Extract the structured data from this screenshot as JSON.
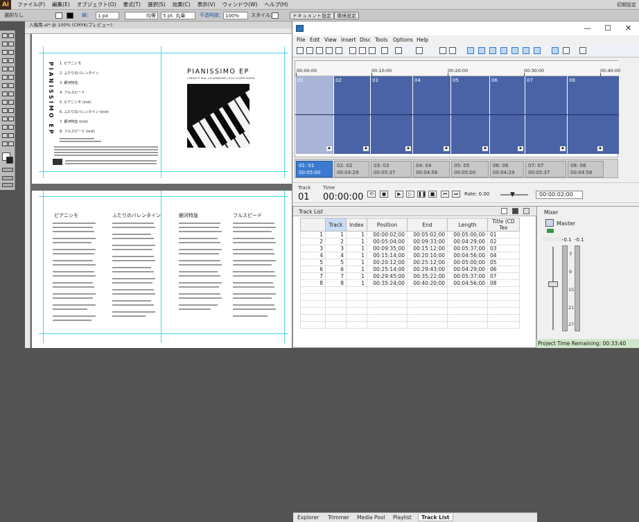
{
  "illustrator": {
    "logo": "Ai",
    "menus": [
      "ファイル(F)",
      "編集(E)",
      "オブジェクト(O)",
      "書式(T)",
      "選択(S)",
      "効果(C)",
      "表示(V)",
      "ウィンドウ(W)",
      "ヘルプ(H)"
    ],
    "workspace": "初期設定",
    "control": {
      "selection": "選択なし",
      "stroke_label": "線：",
      "stroke_value": "1 px",
      "stroke_style": "均等",
      "brush": "5 pt. 丸筆",
      "opacity_label": "不透明度：",
      "opacity_value": "100%",
      "style_label": "スタイル：",
      "doc_setup": "ドキュメント設定",
      "prefs": "環境設定"
    },
    "doc_tab": "入稿用.ai* @ 100% (CMYK/プレビュー)",
    "front": {
      "title": "PIANISSIMO EP",
      "subtitle": "J PROJECT feat. LIA KAWASAKI / ELLY COVER ALBUM",
      "spine_title": "PIANISSIMO EP",
      "tracks": [
        "1. ピアニシモ",
        "2. ふたりのバレンタイン",
        "3. 銀河特急",
        "4. フルスピード",
        "5. ピアニシモ (inst)",
        "6. ふたりのバレンタイン (inst)",
        "7. 銀河特急 (inst)",
        "8. フルスピード (inst)"
      ]
    },
    "lyrics_titles": [
      "ピアニシモ",
      "ふたりのバレンタイン",
      "銀河特急",
      "フルスピード"
    ]
  },
  "soundforge": {
    "menus": [
      "File",
      "Edit",
      "View",
      "Insert",
      "Disc",
      "Tools",
      "Options",
      "Help"
    ],
    "window_controls": [
      "—",
      "☐",
      "✕"
    ],
    "ruler": [
      "00:00:00",
      "00:10:00",
      "00:20:00",
      "00:30:00",
      "00:40:00"
    ],
    "segments": [
      "01",
      "02",
      "03",
      "04",
      "05",
      "06",
      "07",
      "08"
    ],
    "markers": [
      {
        "top": "01: 01",
        "bottom": "00:05:00"
      },
      {
        "top": "02: 02",
        "bottom": "00:04:29"
      },
      {
        "top": "03: 03",
        "bottom": "00:05:37"
      },
      {
        "top": "04: 04",
        "bottom": "00:04:56"
      },
      {
        "top": "05: 05",
        "bottom": "00:05:00"
      },
      {
        "top": "06: 06",
        "bottom": "00:04:29"
      },
      {
        "top": "07: 07",
        "bottom": "00:05:37"
      },
      {
        "top": "08: 08",
        "bottom": "00:04:56"
      }
    ],
    "transport": {
      "track_label": "Track",
      "track_value": "01",
      "time_label": "Time",
      "time_value": "00:00:00",
      "rate": "Rate: 0.00",
      "time_field": "00:00:02;00"
    },
    "tracklist": {
      "title": "Track List",
      "columns": [
        "",
        "Track",
        "Index",
        "Position",
        "End",
        "Length",
        "Title (CD Tex"
      ],
      "rows": [
        [
          "1",
          "1",
          "1",
          "00:00:02;00",
          "00:05:02;00",
          "00:05:00;00",
          "01"
        ],
        [
          "2",
          "2",
          "1",
          "00:05:04;00",
          "00:09:33;00",
          "00:04:29;00",
          "02"
        ],
        [
          "3",
          "3",
          "1",
          "00:09:35;00",
          "00:15:12;00",
          "00:05:37;00",
          "03"
        ],
        [
          "4",
          "4",
          "1",
          "00:15:14;00",
          "00:20:10;00",
          "00:04:56;00",
          "04"
        ],
        [
          "5",
          "5",
          "1",
          "00:20:12;00",
          "00:25:12;00",
          "00:05:00;00",
          "05"
        ],
        [
          "6",
          "6",
          "1",
          "00:25:14;00",
          "00:29:43;00",
          "00:04:29;00",
          "06"
        ],
        [
          "7",
          "7",
          "1",
          "00:29:45;00",
          "00:35:22;00",
          "00:05:37;00",
          "07"
        ],
        [
          "8",
          "8",
          "1",
          "00:35:24;00",
          "00:40:20;00",
          "00:04:56;00",
          "08"
        ]
      ]
    },
    "tabs": [
      "Explorer",
      "Trimmer",
      "Media Pool",
      "Playlist",
      "Track List"
    ],
    "mixer": {
      "title": "Mixer",
      "master": "Master",
      "peak_left": "-0.1",
      "peak_right": "-0.1",
      "scale": [
        "3",
        "9",
        "15",
        "21",
        "27"
      ]
    },
    "status": "Project Time Remaining: 00:33:40"
  }
}
